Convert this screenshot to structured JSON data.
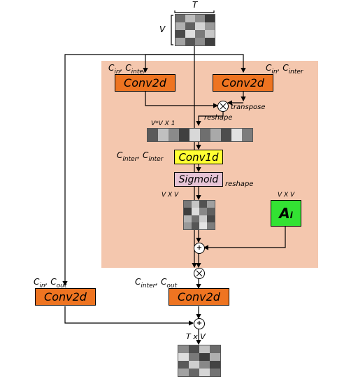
{
  "diagram": {
    "top_T": "T",
    "top_V": "V",
    "cin_cinter_left": "C",
    "cin_cinter_left_sub1": "in",
    "cin_cinter_left_mid": ", C",
    "cin_cinter_left_sub2": "inter",
    "cin_cinter_right": "C",
    "cin_cinter_right_sub1": "in",
    "cin_cinter_right_mid": ", C",
    "cin_cinter_right_sub2": "inter",
    "conv2d_a": "Conv2d",
    "conv2d_b": "Conv2d",
    "transpose": "transpose",
    "reshape1": "reshape",
    "vvx1": "V*V X 1",
    "cinter_cinter": "C",
    "cinter_cinter_sub1": "inter",
    "cinter_cinter_mid": ", C",
    "cinter_cinter_sub2": "inter",
    "conv1d": "Conv1d",
    "sigmoid": "Sigmoid",
    "reshape2": "reshape",
    "vxv_left": "V X V",
    "vxv_right": "V X V",
    "Ai": "A",
    "Ai_sub": "i",
    "cin_cout": "C",
    "cin_cout_sub1": "in",
    "cin_cout_mid": ", C",
    "cin_cout_sub2": "out",
    "cinter_cout": "C",
    "cinter_cout_sub1": "inter",
    "cinter_cout_mid": ", C",
    "cinter_cout_sub2": "out",
    "conv2d_c": "Conv2d",
    "conv2d_d": "Conv2d",
    "txv": "T x V"
  }
}
